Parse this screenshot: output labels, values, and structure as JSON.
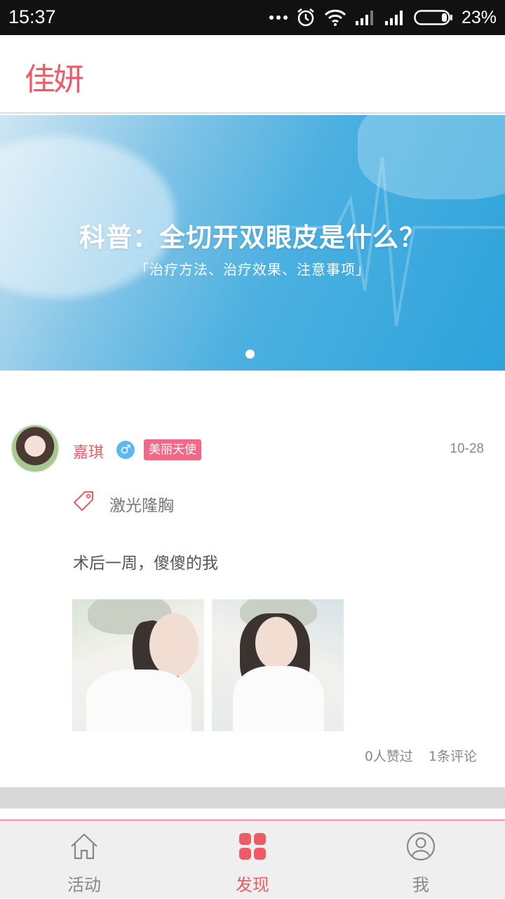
{
  "status_bar": {
    "time": "15:37",
    "battery": "23%"
  },
  "header": {
    "logo": "佳妍"
  },
  "banner": {
    "title": "科普：全切开双眼皮是什么？",
    "subtitle": "「治疗方法、治疗效果、注意事项」",
    "active_dot": 1,
    "dot_count": 1
  },
  "post": {
    "author": "嘉琪",
    "gender_symbol": "♂",
    "role": "美丽天使",
    "date": "10-28",
    "tag": "激光隆胸",
    "text": "术后一周，傻傻的我",
    "photo_count": 2,
    "likes": "0人赞过",
    "comments": "1条评论"
  },
  "tabs": [
    {
      "label": "活动",
      "icon": "home-icon",
      "active": false
    },
    {
      "label": "发现",
      "icon": "grid-icon",
      "active": true
    },
    {
      "label": "我",
      "icon": "user-icon",
      "active": false
    }
  ],
  "colors": {
    "accent": "#ef5a69",
    "badge": "#f26887",
    "gender": "#5eb8f0",
    "banner": "#2ca3db"
  }
}
